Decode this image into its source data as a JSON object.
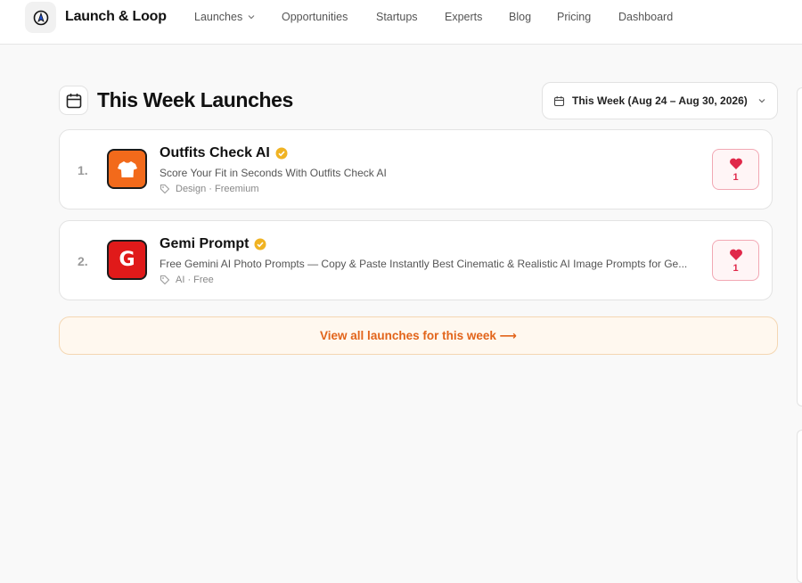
{
  "header": {
    "brand": "Launch & Loop",
    "nav": [
      {
        "label": "Launches",
        "has_dropdown": true
      },
      {
        "label": "Opportunities"
      },
      {
        "label": "Startups"
      },
      {
        "label": "Experts"
      },
      {
        "label": "Blog"
      },
      {
        "label": "Pricing"
      },
      {
        "label": "Dashboard"
      }
    ]
  },
  "main": {
    "title": "This Week Launches",
    "week_select": {
      "label": "This Week (Aug 24 – Aug 30, 2026)"
    },
    "launches": [
      {
        "rank": "1.",
        "name": "Outfits Check AI",
        "verified": true,
        "description": "Score Your Fit in Seconds With Outfits Check AI",
        "tags": "Design · Freemium",
        "upvotes": "1",
        "icon": "tshirt-icon",
        "icon_color": "#f26a1b"
      },
      {
        "rank": "2.",
        "name": "Gemi Prompt",
        "verified": true,
        "description": "Free Gemini AI Photo Prompts — Copy & Paste Instantly Best Cinematic & Realistic AI Image Prompts for Ge...",
        "tags": "AI · Free",
        "upvotes": "1",
        "icon": "letter-g-icon",
        "icon_letter": "G",
        "icon_color": "#e01a1a"
      }
    ],
    "view_all": "View all launches for this week ⟶"
  },
  "colors": {
    "accent": "#e2641a",
    "heart": "#e0284a",
    "verified": "#f0b323"
  }
}
